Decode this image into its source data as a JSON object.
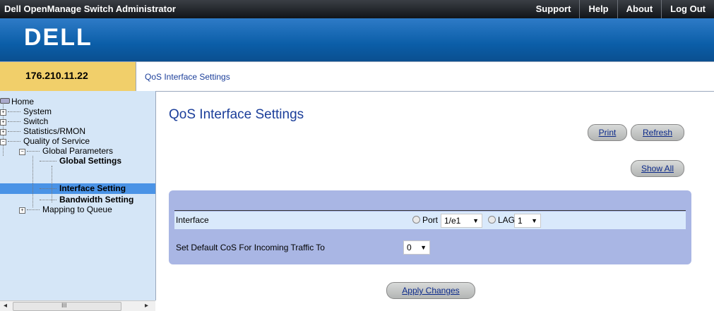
{
  "header": {
    "app_title": "Dell OpenManage Switch Administrator",
    "nav": [
      "Support",
      "Help",
      "About",
      "Log Out"
    ],
    "logo": "DELL"
  },
  "info": {
    "ip": "176.210.11.22",
    "breadcrumb": "QoS Interface Settings"
  },
  "tree": {
    "home": "Home",
    "system": "System",
    "switch": "Switch",
    "statistics": "Statistics/RMON",
    "qos": "Quality of Service",
    "global_params": "Global Parameters",
    "global_settings": "Global Settings",
    "interface_settings": "Interface Setting",
    "bandwidth_settings": "Bandwidth Setting",
    "mapping": "Mapping to Queue",
    "scroll_grip": "III"
  },
  "main": {
    "title": "QoS Interface Settings",
    "print": "Print",
    "refresh": "Refresh",
    "show_all": "Show All",
    "apply": "Apply Changes",
    "form": {
      "interface_label": "Interface",
      "port_label": "Port",
      "port_value": "1/e1",
      "lag_label": "LAG",
      "lag_value": "1",
      "default_cos_label": "Set Default CoS For Incoming Traffic To",
      "default_cos_value": "0"
    }
  }
}
